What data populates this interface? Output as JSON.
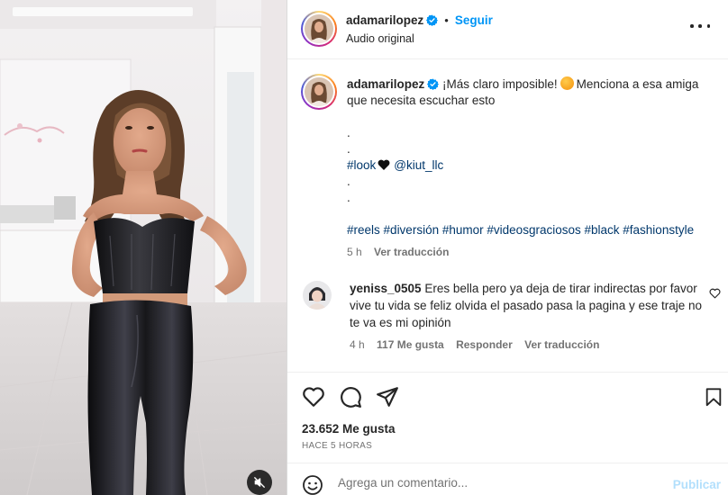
{
  "post": {
    "username": "adamarilopez",
    "verified": true,
    "separator": "•",
    "follow_label": "Seguir",
    "audio_label": "Audio original",
    "more_icon": "more-horizontal-icon"
  },
  "caption": {
    "username": "adamarilopez",
    "lines": [
      "¡Más claro imposible!",
      "Menciona a esa amiga",
      "que necesita escuchar esto",
      ".",
      ".",
      ".",
      "."
    ],
    "look_tag": "#look",
    "mention": "@kiut_llc",
    "hashtags": [
      "#reels",
      "#diversión",
      "#humor",
      "#videosgraciosos",
      "#black",
      "#fashionstyle"
    ],
    "time": "5 h",
    "translate_label": "Ver traducción"
  },
  "comment": {
    "username": "yeniss_0505",
    "text": "Eres bella pero ya deja de tirar indirectas por favor vive tu vida se feliz olvida el pasado pasa la pagina y ese traje no te va es mi opinión",
    "time": "4 h",
    "likes": "117 Me gusta",
    "reply_label": "Responder",
    "translate_label": "Ver traducción"
  },
  "stats": {
    "likes": "23.652 Me gusta",
    "time_ago": "HACE 5 HORAS"
  },
  "composer": {
    "placeholder": "Agrega un comentario...",
    "publish_label": "Publicar"
  },
  "colors": {
    "link_blue": "#0095f6",
    "hashtag": "#00376b",
    "muted": "#737373",
    "publish_disabled": "#b2dffc"
  }
}
